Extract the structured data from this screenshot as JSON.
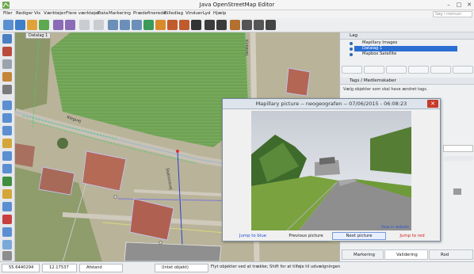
{
  "window": {
    "title": "Java OpenStreetMap Editor"
  },
  "menu": {
    "items": [
      "Filer",
      "Rediger",
      "Vis",
      "Værktøjer",
      "Flere værktøjer",
      "Data",
      "Markering",
      "Prædefinerede",
      "Billedlag",
      "Vinduer",
      "Lyd",
      "Hjælp"
    ],
    "search_placeholder": "Søg i menuer"
  },
  "map": {
    "layer_tag": "Datalag 1",
    "street_labels": [
      "Klegvej",
      "Stationsvej",
      "Kirkevej"
    ]
  },
  "layers_panel": {
    "title": "Lag",
    "items": [
      "Mapillary Images",
      "Datalag 1",
      "Mapbox Satellite"
    ],
    "active_index": 1
  },
  "tags_panel": {
    "title": "Tags / Medlemskaber",
    "hint": "Vælg objekter som skal have ændret tags."
  },
  "dialog": {
    "title": "Mapillary picture -- neogeografen -- 07/06/2015 - 06:08:23",
    "close_label": "✕",
    "view_link": "View in website",
    "links": [
      "Jump to blue",
      "Previous picture",
      "Next picture",
      "Jump to red"
    ],
    "colors": {
      "blue": "#1f4fd6",
      "red": "#d42020"
    }
  },
  "status": {
    "lat": "55.6440294",
    "lon": "12.17537",
    "length_label": "Afstand",
    "selection_label": "(Intet objekt)",
    "message": "Flyt objekter ved at trække; Shift for at tilføje til udvælgningen (Ctrl for at skifte); Shift-Ctrl for at rotere valgte; Alt-Ctrl for at skalere valgte; eller skift valg"
  },
  "tabs": [
    "Markering",
    "Validering",
    "Rod"
  ],
  "accent_color": "#2b6fd3"
}
